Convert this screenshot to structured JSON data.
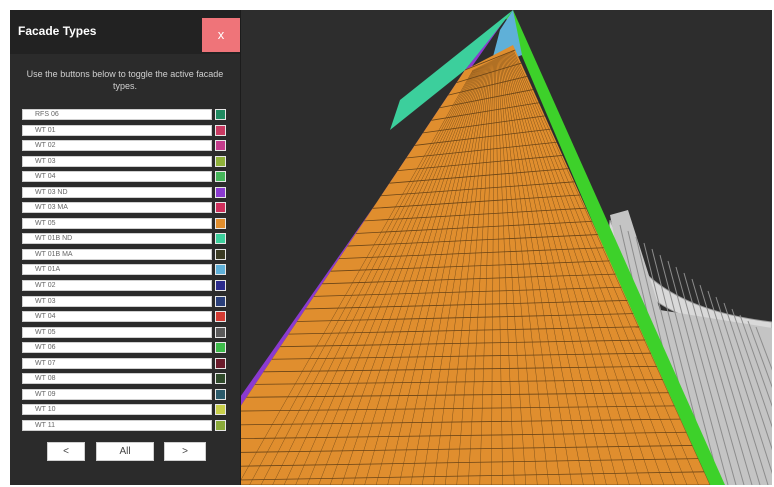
{
  "panel": {
    "title": "Facade Types",
    "close_label": "x",
    "instructions": "Use the buttons below to toggle the active facade types.",
    "types": [
      {
        "label": "RFS 06",
        "color": "#1f8a60"
      },
      {
        "label": "WT 01",
        "color": "#c93a62"
      },
      {
        "label": "WT 02",
        "color": "#c43c8c"
      },
      {
        "label": "WT 03",
        "color": "#8fb13a"
      },
      {
        "label": "WT 04",
        "color": "#45b65a"
      },
      {
        "label": "WT 03 ND",
        "color": "#8b3ad0"
      },
      {
        "label": "WT 03 MA",
        "color": "#cf2f5c"
      },
      {
        "label": "WT 05",
        "color": "#e08e2e"
      },
      {
        "label": "WT 01B ND",
        "color": "#3ccf9c"
      },
      {
        "label": "WT 01B MA",
        "color": "#3a3a22"
      },
      {
        "label": "WT 01A",
        "color": "#5fb0d8"
      },
      {
        "label": "WT 02",
        "color": "#2b2a8c"
      },
      {
        "label": "WT 03",
        "color": "#2a3f7a"
      },
      {
        "label": "WT 04",
        "color": "#d23a32"
      },
      {
        "label": "WT 05",
        "color": "#5a5a5a"
      },
      {
        "label": "WT 06",
        "color": "#3dbb4a"
      },
      {
        "label": "WT 07",
        "color": "#6a1a2a"
      },
      {
        "label": "WT 08",
        "color": "#2f4a2a"
      },
      {
        "label": "WT 09",
        "color": "#2a5a6a"
      },
      {
        "label": "WT 10",
        "color": "#c8cf4a"
      },
      {
        "label": "WT 11",
        "color": "#8aaa3a"
      }
    ],
    "nav": {
      "prev_label": "<",
      "all_label": "All",
      "next_label": ">"
    }
  },
  "scene": {
    "background": "#2d2d2d",
    "colors": {
      "orange": "#e08e2e",
      "purple": "#8b3ad0",
      "teal": "#3ccf9c",
      "lightblue": "#5fb0d8",
      "green": "#3dd12a",
      "neighbor_building": "#c4c4c4"
    }
  }
}
